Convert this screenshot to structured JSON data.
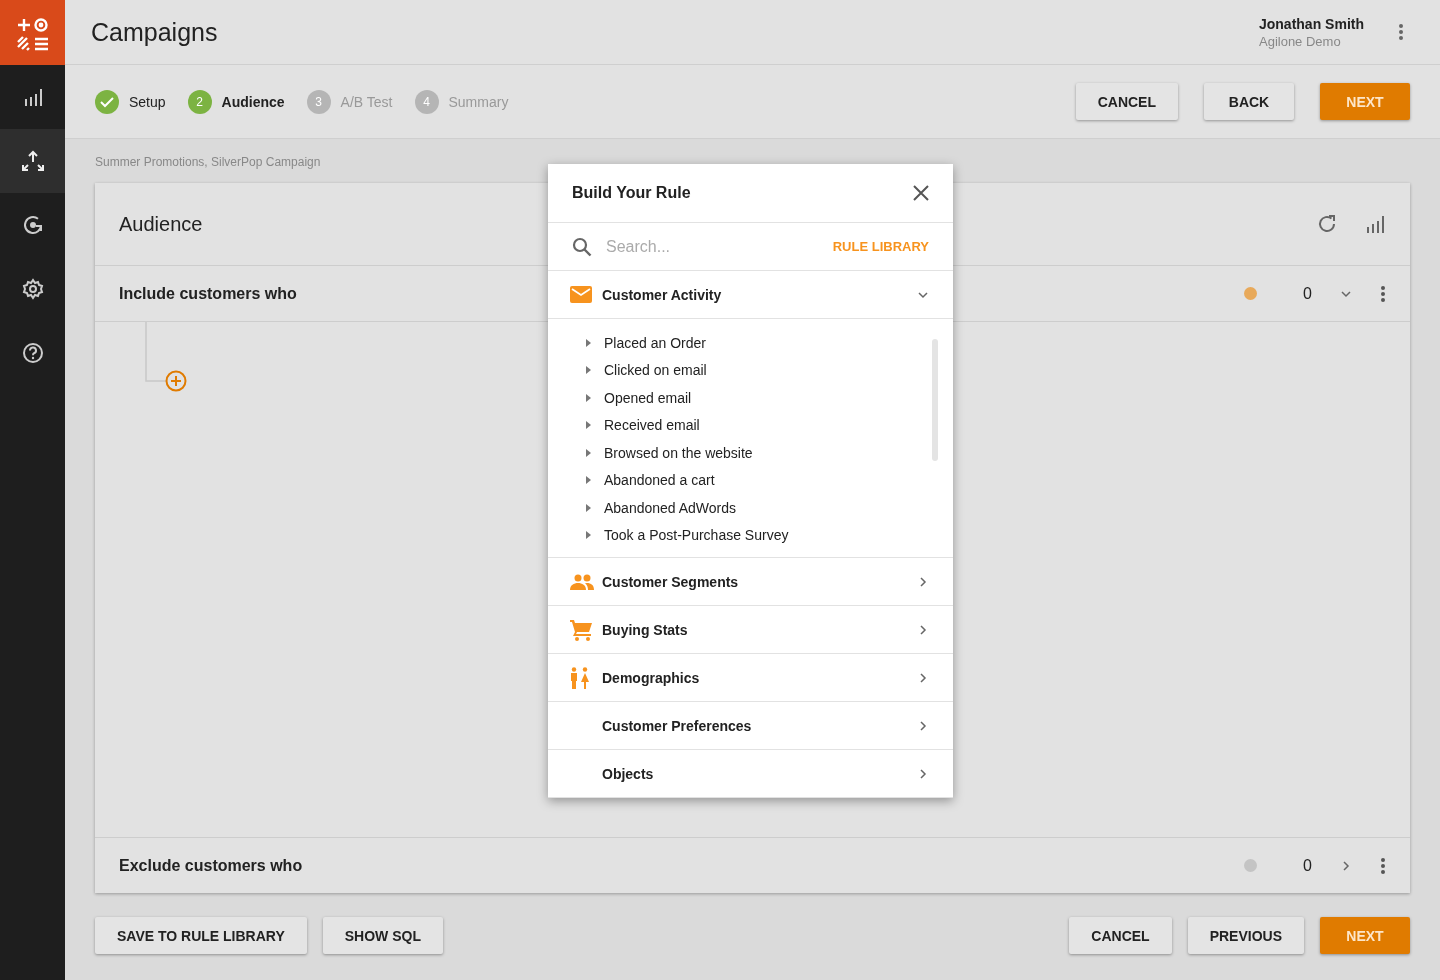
{
  "app": {
    "title": "Campaigns",
    "user": {
      "name": "Jonathan Smith",
      "org": "Agilone Demo"
    }
  },
  "sidebar": {
    "items": [
      {
        "kind": "chart",
        "selected": false
      },
      {
        "kind": "share",
        "selected": true
      },
      {
        "kind": "refresh",
        "selected": false
      },
      {
        "kind": "settings",
        "selected": false
      },
      {
        "kind": "help",
        "selected": false
      }
    ]
  },
  "steps": [
    {
      "label": "Setup",
      "done": true,
      "selected": false
    },
    {
      "label": "Audience",
      "number": "2",
      "done": false,
      "selected": true
    },
    {
      "label": "A/B Test",
      "number": "3",
      "done": false,
      "selected": false
    },
    {
      "label": "Summary",
      "number": "4",
      "done": false,
      "selected": false
    }
  ],
  "top_buttons": [
    {
      "label": "CANCEL",
      "primary": false
    },
    {
      "label": "BACK",
      "primary": false
    },
    {
      "label": "NEXT",
      "primary": true
    }
  ],
  "breadcrumb": "Summer Promotions, SilverPop Campaign",
  "card": {
    "title": "Audience",
    "sections": [
      {
        "label": "Include customers who",
        "count": "0",
        "color": "#e8a95a",
        "expanded": true
      },
      {
        "label": "Exclude customers who",
        "count": "0",
        "color": "#c4c4c4",
        "expanded": false
      }
    ]
  },
  "bottom_left_buttons": [
    {
      "label": "SAVE TO RULE LIBRARY",
      "primary": false
    },
    {
      "label": "SHOW SQL",
      "primary": false
    }
  ],
  "bottom_right_buttons": [
    {
      "label": "CANCEL",
      "primary": false
    },
    {
      "label": "PREVIOUS",
      "primary": false
    },
    {
      "label": "NEXT",
      "primary": true
    }
  ],
  "modal": {
    "title": "Build Your Rule",
    "search": {
      "placeholder": "Search..."
    },
    "link": "RULE LIBRARY",
    "categories": [
      {
        "label": "Customer Activity",
        "kind": "mail",
        "expanded": true,
        "children": [
          "Placed an Order",
          "Clicked on email",
          "Opened email",
          "Received email",
          "Browsed on the website",
          "Abandoned a cart",
          "Abandoned AdWords",
          "Took a Post-Purchase Survey"
        ]
      },
      {
        "label": "Customer Segments",
        "kind": "people",
        "expanded": false
      },
      {
        "label": "Buying Stats",
        "kind": "cart",
        "expanded": false
      },
      {
        "label": "Demographics",
        "kind": "demographics",
        "expanded": false
      },
      {
        "label": "Customer Preferences",
        "kind": "none",
        "expanded": false
      },
      {
        "label": "Objects",
        "kind": "none",
        "expanded": false
      }
    ]
  }
}
